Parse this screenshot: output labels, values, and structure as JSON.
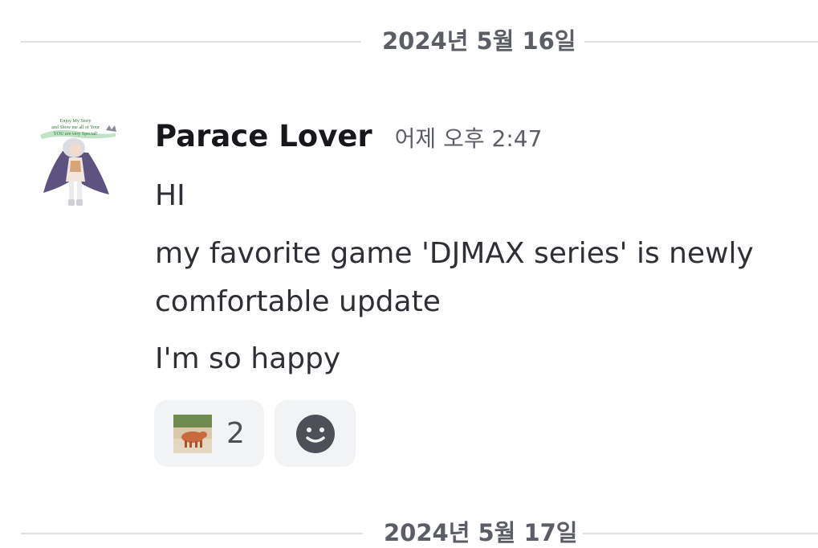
{
  "dividers": {
    "first_date": "2024년 5월 16일",
    "second_date": "2024년 5월 17일"
  },
  "message": {
    "username": "Parace Lover",
    "timestamp": "어제 오후 2:47",
    "avatar_caption": [
      "Enjoy My Story",
      "and Show me all of Your",
      "YOU are very Special!"
    ],
    "lines": [
      "HI",
      "my favorite game 'DJMAX series' is newly",
      "comfortable update",
      "I'm so happy"
    ]
  },
  "reactions": [
    {
      "emoji_icon": "custom-pig-emoji",
      "count": "2"
    },
    {
      "emoji_icon": "add-reaction-smiley-icon"
    }
  ],
  "colors": {
    "divider_line": "#e1e2e6",
    "muted_text": "#5c5e66",
    "reaction_bg": "#f2f3f5",
    "add_reaction_icon": "#4e5058"
  }
}
